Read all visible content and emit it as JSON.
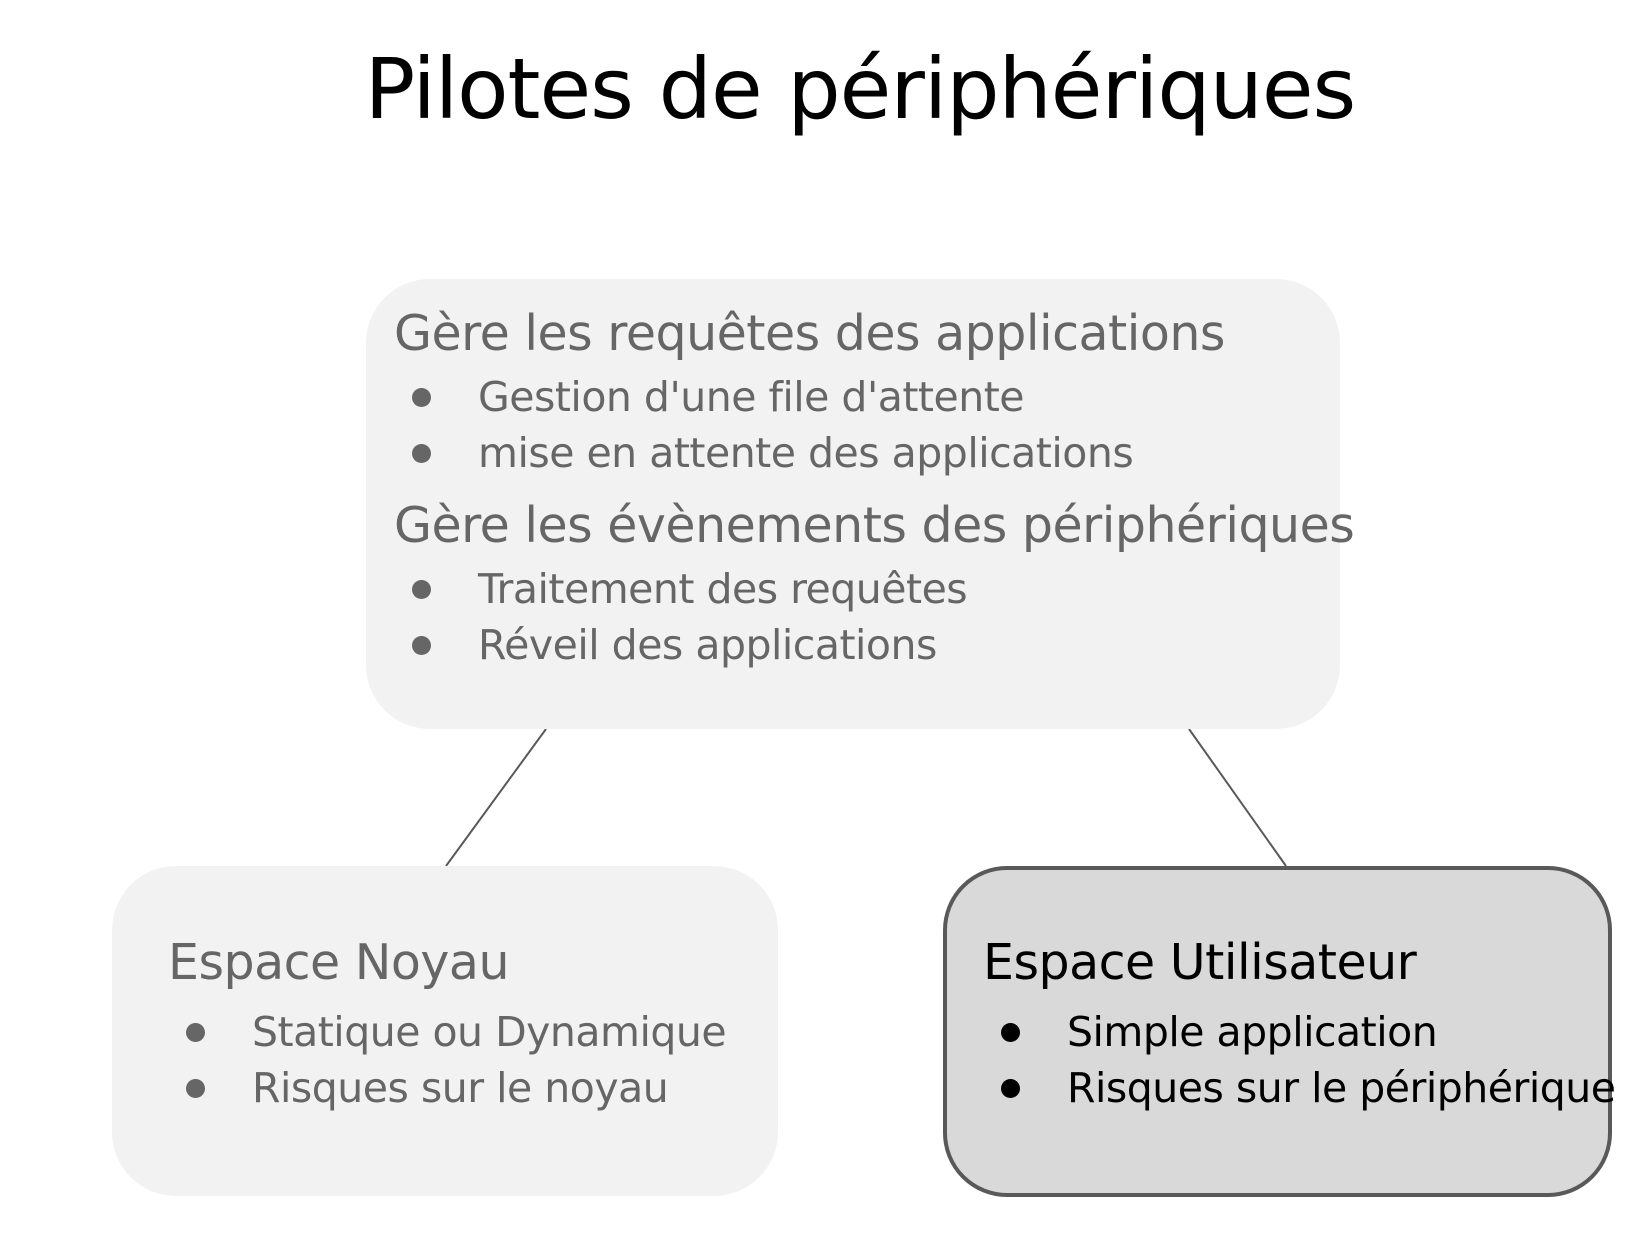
{
  "title": "Pilotes de périphériques",
  "top_box": {
    "sections": [
      {
        "heading": "Gère les requêtes des applications",
        "items": [
          "Gestion d'une file d'attente",
          "mise en attente des applications"
        ]
      },
      {
        "heading": "Gère les évènements des périphériques",
        "items": [
          "Traitement des requêtes",
          "Réveil des applications"
        ]
      }
    ]
  },
  "left_box": {
    "heading": "Espace Noyau",
    "items": [
      "Statique ou Dynamique",
      "Risques sur le noyau"
    ]
  },
  "right_box": {
    "heading": "Espace Utilisateur",
    "items": [
      "Simple application",
      "Risques sur le périphérique"
    ]
  },
  "colors": {
    "light_box": "#f2f2f2",
    "highlight_box": "#d9d9d9",
    "highlight_border": "#595959",
    "muted_text": "#666666",
    "dark_text": "#000000"
  }
}
